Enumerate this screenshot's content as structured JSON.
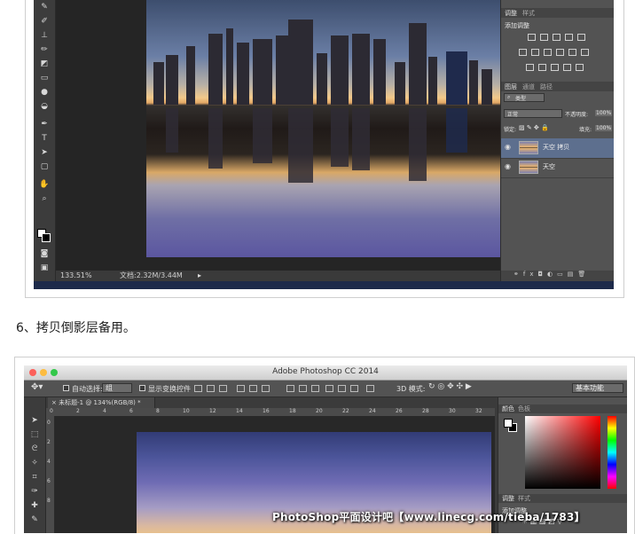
{
  "shot1": {
    "status_zoom": "133.51%",
    "status_doc": "文档:2.32M/3.44M",
    "adjust_tabs": [
      "调整",
      "样式"
    ],
    "adjust_title": "添加调整",
    "layer_tabs": [
      "图层",
      "通道",
      "路径"
    ],
    "kind_label": "类型",
    "blend_mode": "正常",
    "opacity_label": "不透明度:",
    "opacity_value": "100%",
    "lock_label": "锁定:",
    "fill_label": "填充:",
    "fill_value": "100%",
    "layers": [
      {
        "name": "天空 拷贝",
        "selected": true
      },
      {
        "name": "天空",
        "selected": false
      }
    ]
  },
  "caption": "6、拷贝倒影层备用。",
  "shot2": {
    "app_title": "Adobe Photoshop CC 2014",
    "auto_select_label": "自动选择:",
    "auto_select_value": "组",
    "show_transform_label": "显示变换控件",
    "mode_3d_label": "3D 模式:",
    "workspace": "基本功能",
    "doc_tab": "未标题-1 @ 134%(RGB/8) *",
    "ruler_numbers": [
      "0",
      "2",
      "4",
      "6",
      "8",
      "10",
      "12",
      "14",
      "16",
      "18",
      "20",
      "22",
      "24",
      "26",
      "28",
      "30",
      "32"
    ],
    "color_tabs": [
      "颜色",
      "色板"
    ],
    "adjust_tabs": [
      "调整",
      "样式"
    ],
    "adjust_title": "添加调整"
  },
  "watermark": "PhotoShop平面设计吧【www.linecg.com/tieba/1783】",
  "colors": {
    "selected_layer": "#5d6f8e",
    "panel": "#535353",
    "toolbar": "#3c3c3c"
  }
}
